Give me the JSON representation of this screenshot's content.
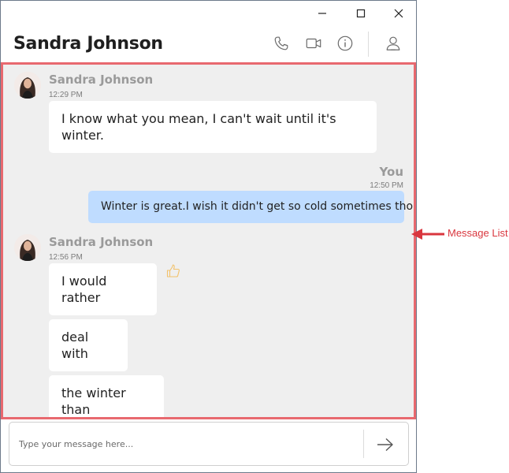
{
  "window": {
    "controls": [
      "minimize",
      "maximize",
      "close"
    ]
  },
  "header": {
    "title": "Sandra Johnson",
    "icons": [
      "phone-icon",
      "video-icon",
      "info-icon",
      "person-icon"
    ]
  },
  "messages": [
    {
      "sender": "Sandra Johnson",
      "time": "12:29 PM",
      "bubbles": [
        {
          "line1": "I know what you mean, I can't wait until it's",
          "line2": "winter."
        }
      ]
    },
    {
      "sender": "You",
      "time": "12:50 PM",
      "text": "Winter is great.I wish it didn't get so cold sometimes though."
    },
    {
      "sender": "Sandra Johnson",
      "time": "12:56 PM",
      "bubbles": [
        {
          "line1": "I would",
          "line2": "rather"
        },
        {
          "line1": "deal",
          "line2": "with"
        },
        {
          "line1": "the winter",
          "line2": "than"
        }
      ],
      "reaction_icon": "thumbs-up-icon"
    }
  ],
  "composer": {
    "placeholder": "Type your message here..."
  },
  "annotation": {
    "label": "Message List",
    "color": "#d9363e"
  },
  "colors": {
    "accent_border": "#e8696f",
    "outgoing_bubble": "#bfdcff",
    "list_background": "#efefef"
  }
}
